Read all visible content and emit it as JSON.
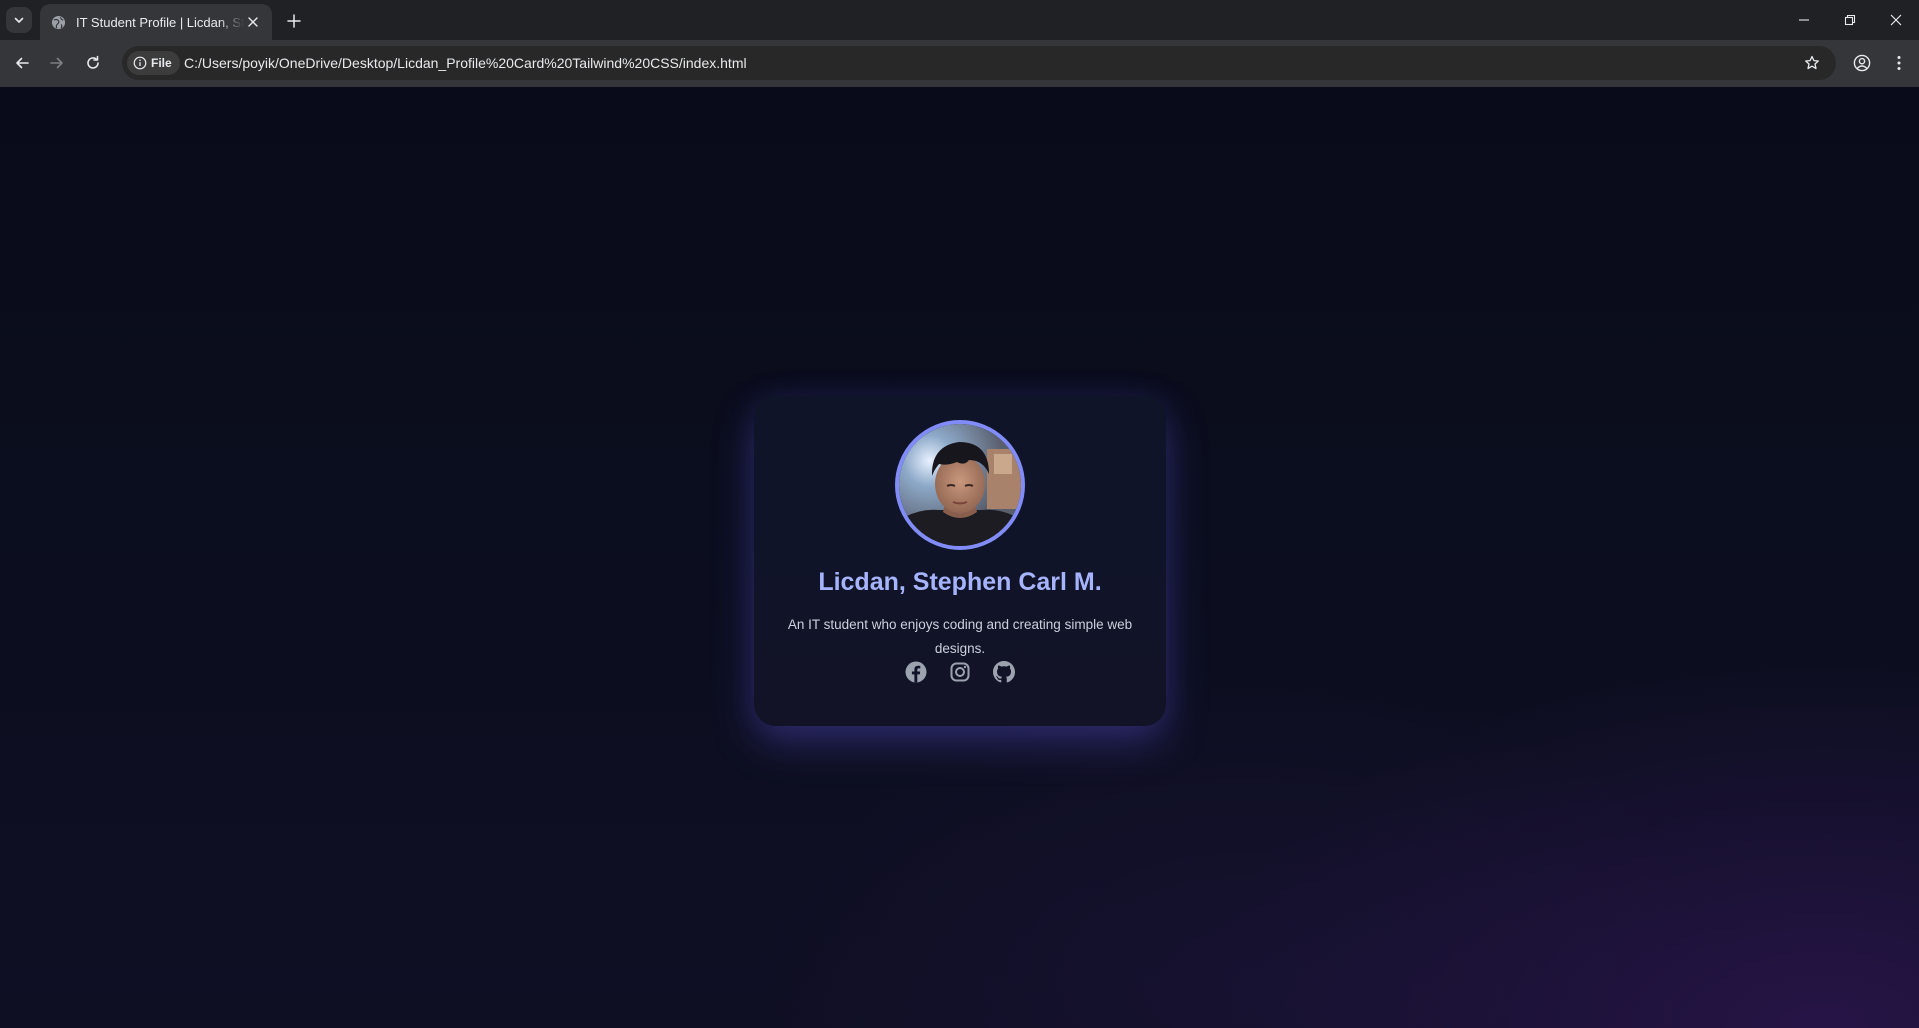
{
  "browser": {
    "tab": {
      "title": "IT Student Profile | Licdan, Stephen Carl M."
    },
    "address_bar": {
      "chip_label": "File",
      "url": "C:/Users/poyik/OneDrive/Desktop/Licdan_Profile%20Card%20Tailwind%20CSS/index.html"
    },
    "icons": [
      "tab-list-icon",
      "globe-icon",
      "close-icon",
      "plus-icon",
      "minimize-icon",
      "restore-icon",
      "close-icon",
      "back-arrow-icon",
      "forward-arrow-icon",
      "reload-icon",
      "info-icon",
      "star-icon",
      "profile-icon",
      "kebab-menu-icon"
    ]
  },
  "profile_card": {
    "name": "Licdan, Stephen Carl M.",
    "bio": "An IT student who enjoys coding and creating simple web designs.",
    "socials": [
      "facebook-icon",
      "instagram-icon",
      "github-icon"
    ],
    "colors": {
      "accent": "#a5b4fc",
      "avatar_ring": "#818cf8",
      "card_bg": "#10142a",
      "glow": "#5c54d6"
    }
  }
}
